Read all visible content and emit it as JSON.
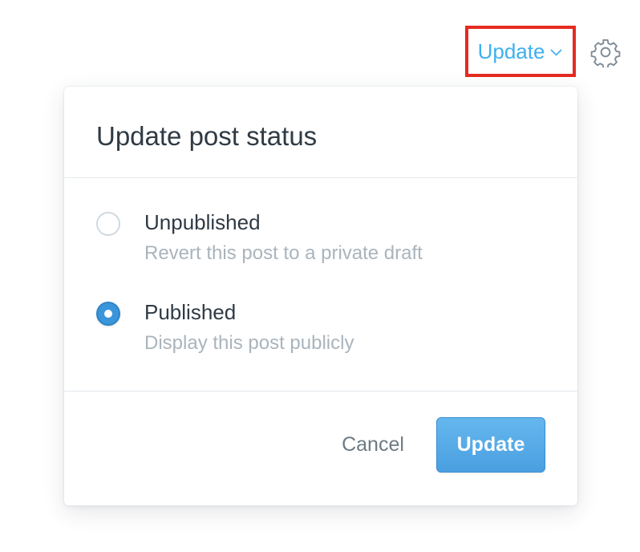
{
  "topbar": {
    "update_label": "Update",
    "chevron_icon": "chevron-down-icon",
    "settings_icon": "gear-icon",
    "accent_color": "#3eb0ef",
    "highlight_color": "#e52b20"
  },
  "panel": {
    "title": "Update post status",
    "options": [
      {
        "label": "Unpublished",
        "description": "Revert this post to a private draft",
        "selected": false
      },
      {
        "label": "Published",
        "description": "Display this post publicly",
        "selected": true
      }
    ],
    "cancel_label": "Cancel",
    "submit_label": "Update",
    "primary_color": "#4a9fe0"
  }
}
